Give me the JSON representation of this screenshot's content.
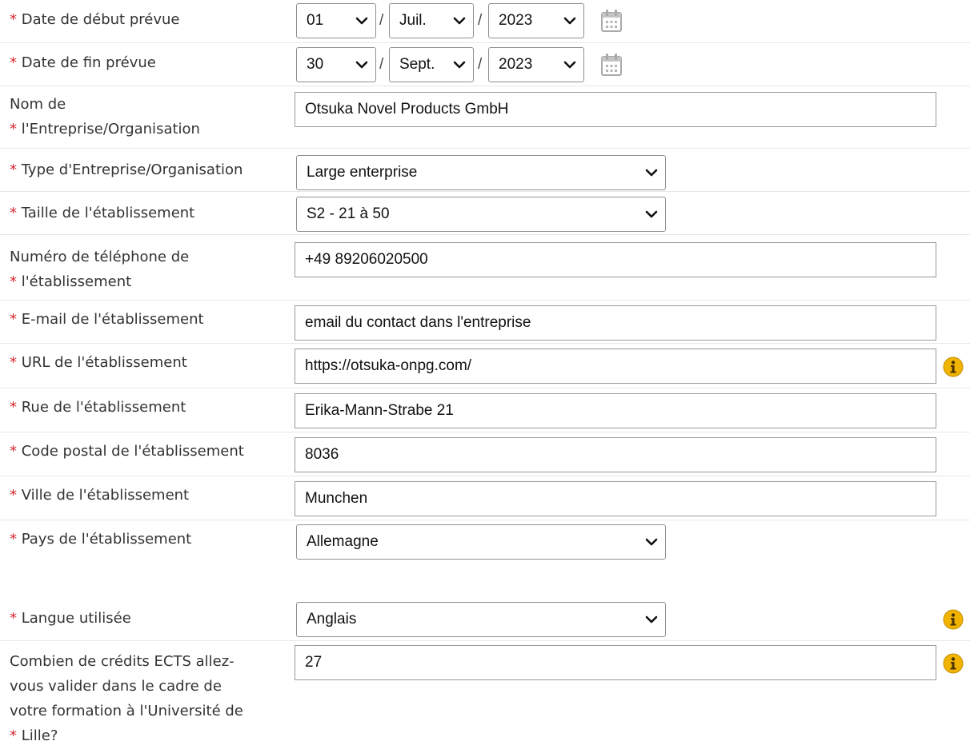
{
  "required_marker": "*",
  "date_separator": "/",
  "start_date": {
    "label": "Date de début prévue",
    "day": "01",
    "month": "Juil.",
    "year": "2023"
  },
  "end_date": {
    "label": "Date de fin prévue",
    "day": "30",
    "month": "Sept.",
    "year": "2023"
  },
  "company_name": {
    "label_line1": "Nom de",
    "label_line2": "l'Entreprise/Organisation",
    "value": "Otsuka Novel Products GmbH"
  },
  "company_type": {
    "label": "Type d'Entreprise/Organisation",
    "value": "Large enterprise"
  },
  "company_size": {
    "label": "Taille de l'établissement",
    "value": "S2 - 21 à 50"
  },
  "phone": {
    "label_line1": "Numéro de téléphone de",
    "label_line2": "l'établissement",
    "value": "+49 89206020500"
  },
  "email": {
    "label": "E-mail de l'établissement",
    "value": "email du contact dans l'entreprise"
  },
  "url": {
    "label": "URL de l'établissement",
    "value": "https://otsuka-onpg.com/"
  },
  "street": {
    "label": "Rue de l'établissement",
    "value": "Erika-Mann-Strabe 21"
  },
  "postal_code": {
    "label": "Code postal de l'établissement",
    "value": "8036"
  },
  "city": {
    "label": "Ville de l'établissement",
    "value": "Munchen"
  },
  "country": {
    "label": "Pays de l'établissement",
    "value": "Allemagne"
  },
  "language": {
    "label": "Langue utilisée",
    "value": "Anglais"
  },
  "ects": {
    "label_line1": "Combien de crédits ECTS allez-",
    "label_line2": "vous valider dans le cadre de",
    "label_line3": "votre formation à l'Université de",
    "label_line4": "Lille?",
    "value": "27"
  },
  "icons": {
    "calendar": "calendar-icon",
    "info": "info-icon",
    "chevron": "chevron-down-icon"
  },
  "colors": {
    "required": "#d9262f",
    "info_badge": "#f0b400",
    "calendar": "#a9a9a9"
  }
}
